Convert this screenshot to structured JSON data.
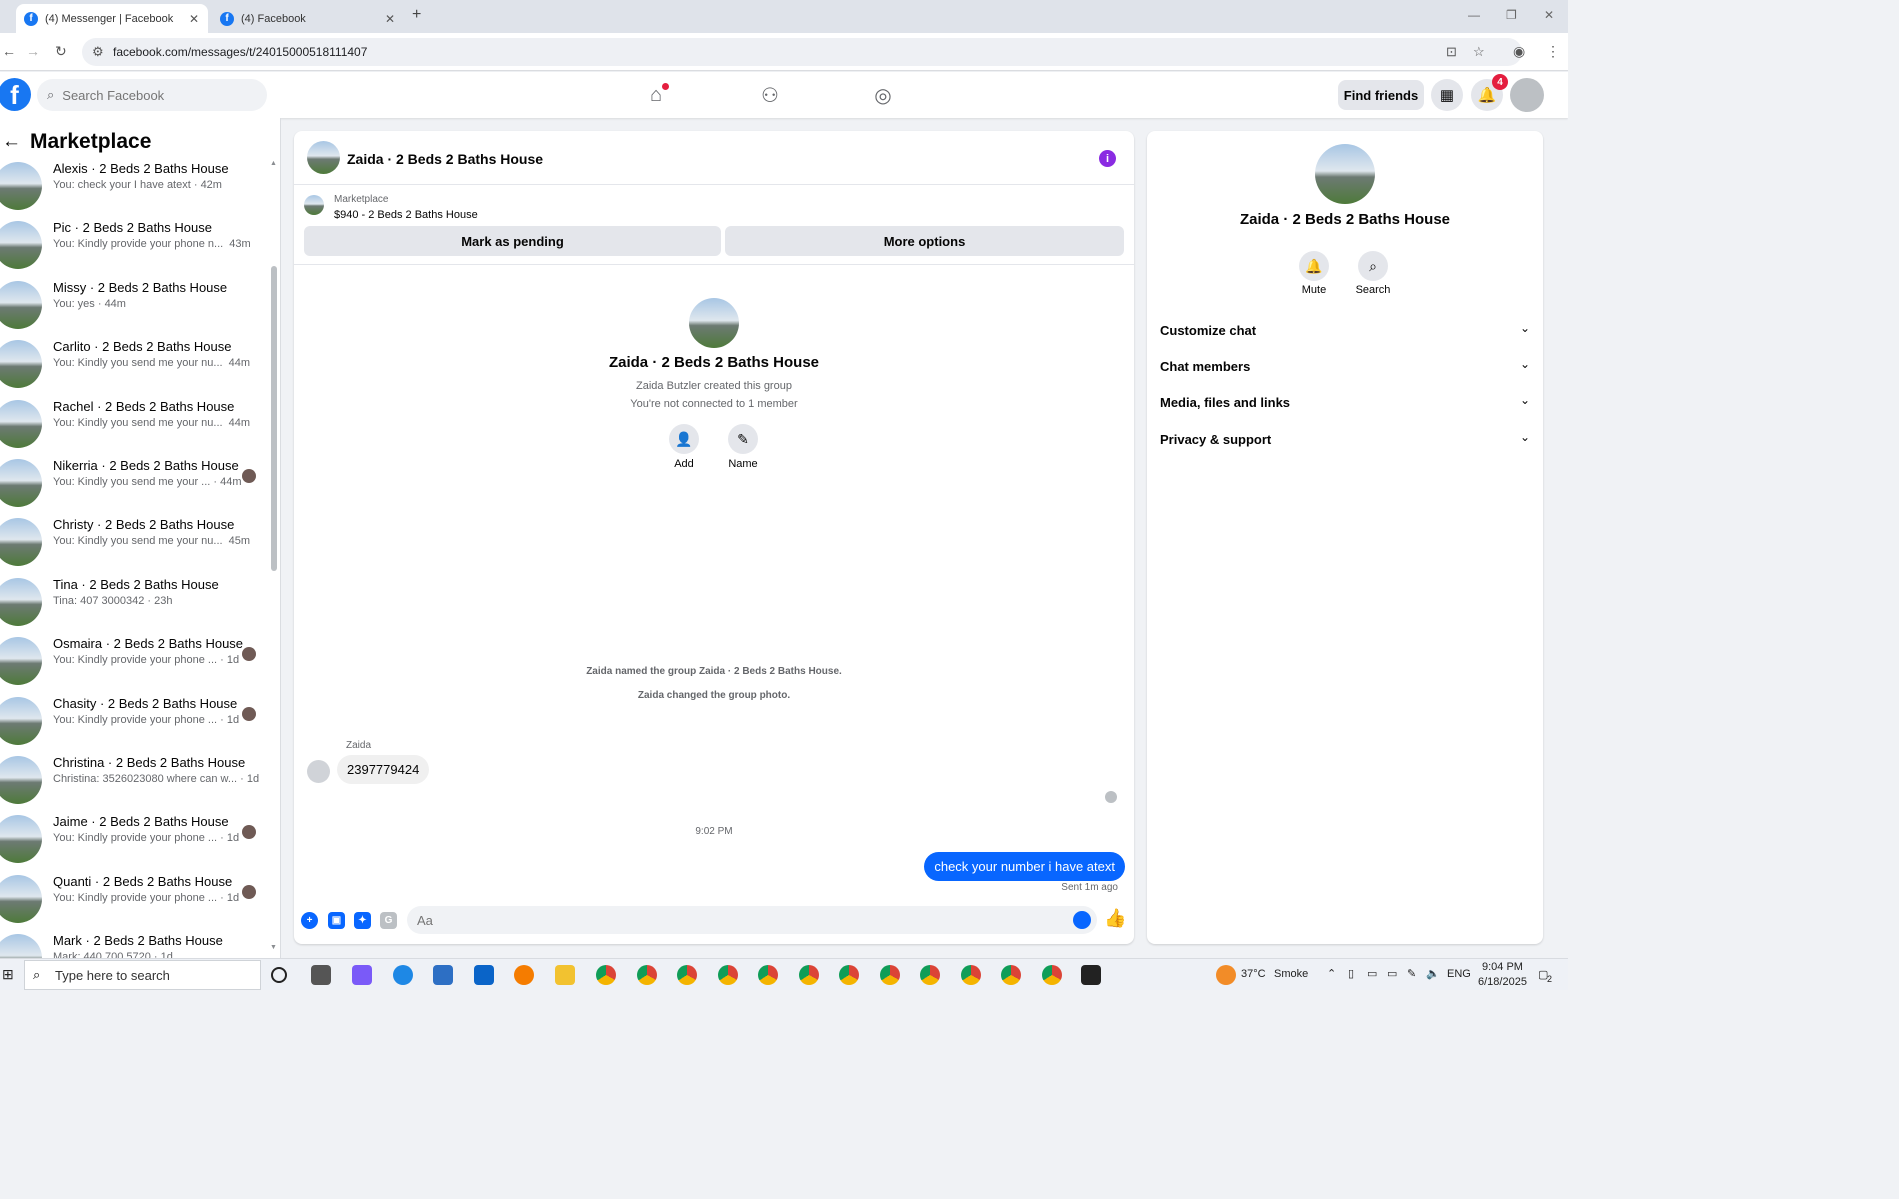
{
  "browser": {
    "tabs": [
      {
        "title": "(4) Messenger | Facebook",
        "active": true
      },
      {
        "title": "(4) Facebook",
        "active": false
      }
    ],
    "url": "facebook.com/messages/t/24015000518111407"
  },
  "header": {
    "search_placeholder": "Search Facebook",
    "find_friends": "Find friends",
    "notification_count": "4"
  },
  "left": {
    "title": "Marketplace",
    "conversations": [
      {
        "name": "Alexis · 2 Beds 2 Baths House",
        "preview": "You: check your I have atext · 42m",
        "time": ""
      },
      {
        "name": "Pic · 2 Beds 2 Baths House",
        "preview": "You: Kindly provide your phone n...",
        "time": "43m"
      },
      {
        "name": "Missy · 2 Beds 2 Baths House",
        "preview": "You: yes · 44m",
        "time": ""
      },
      {
        "name": "Carlito · 2 Beds 2 Baths House",
        "preview": "You: Kindly you send me your nu...",
        "time": "44m"
      },
      {
        "name": "Rachel · 2 Beds 2 Baths House",
        "preview": "You: Kindly you send me your nu...",
        "time": "44m"
      },
      {
        "name": "Nikerria · 2 Beds 2 Baths House",
        "preview": "You: Kindly you send me your ... · 44m",
        "time": ""
      },
      {
        "name": "Christy · 2 Beds 2 Baths House",
        "preview": "You: Kindly you send me your nu...",
        "time": "45m"
      },
      {
        "name": "Tina · 2 Beds 2 Baths House",
        "preview": "Tina: 407 3000342 · 23h",
        "time": ""
      },
      {
        "name": "Osmaira · 2 Beds 2 Baths House",
        "preview": "You: Kindly provide your phone ... · 1d",
        "time": ""
      },
      {
        "name": "Chasity · 2 Beds 2 Baths House",
        "preview": "You: Kindly provide your phone ... · 1d",
        "time": ""
      },
      {
        "name": "Christina · 2 Beds 2 Baths House",
        "preview": "Christina: 3526023080 where can w... · 1d",
        "time": ""
      },
      {
        "name": "Jaime · 2 Beds 2 Baths House",
        "preview": "You: Kindly provide your phone ... · 1d",
        "time": ""
      },
      {
        "name": "Quanti · 2 Beds 2 Baths House",
        "preview": "You: Kindly provide your phone ... · 1d",
        "time": ""
      },
      {
        "name": "Mark · 2 Beds 2 Baths House",
        "preview": "Mark: 440 700 5720 · 1d",
        "time": ""
      }
    ]
  },
  "chat": {
    "title": "Zaida · 2 Beds 2 Baths House",
    "marketplace_label": "Marketplace",
    "listing": "$940 - 2 Beds 2 Baths House",
    "mark_pending": "Mark as pending",
    "more_options": "More options",
    "group_title": "Zaida · 2 Beds 2 Baths House",
    "created_by": "Zaida Butzler created this group",
    "not_connected": "You're not connected to 1 member",
    "add_label": "Add",
    "name_label": "Name",
    "sys1": "Zaida named the group Zaida · 2 Beds 2 Baths House.",
    "sys2": "Zaida changed the group photo.",
    "sender": "Zaida",
    "incoming": "2397779424",
    "timestamp": "9:02 PM",
    "outgoing": "check your number i have atext",
    "sent_status": "Sent 1m ago",
    "composer_placeholder": "Aa"
  },
  "details": {
    "title": "Zaida · 2 Beds 2 Baths House",
    "mute": "Mute",
    "search": "Search",
    "sections": [
      "Customize chat",
      "Chat members",
      "Media, files and links",
      "Privacy & support"
    ]
  },
  "taskbar": {
    "search_placeholder": "Type here to search",
    "weather": "37°C",
    "weather_desc": "Smoke",
    "lang": "ENG",
    "time": "9:04 PM",
    "date": "6/18/2025",
    "notif_count": "2"
  }
}
